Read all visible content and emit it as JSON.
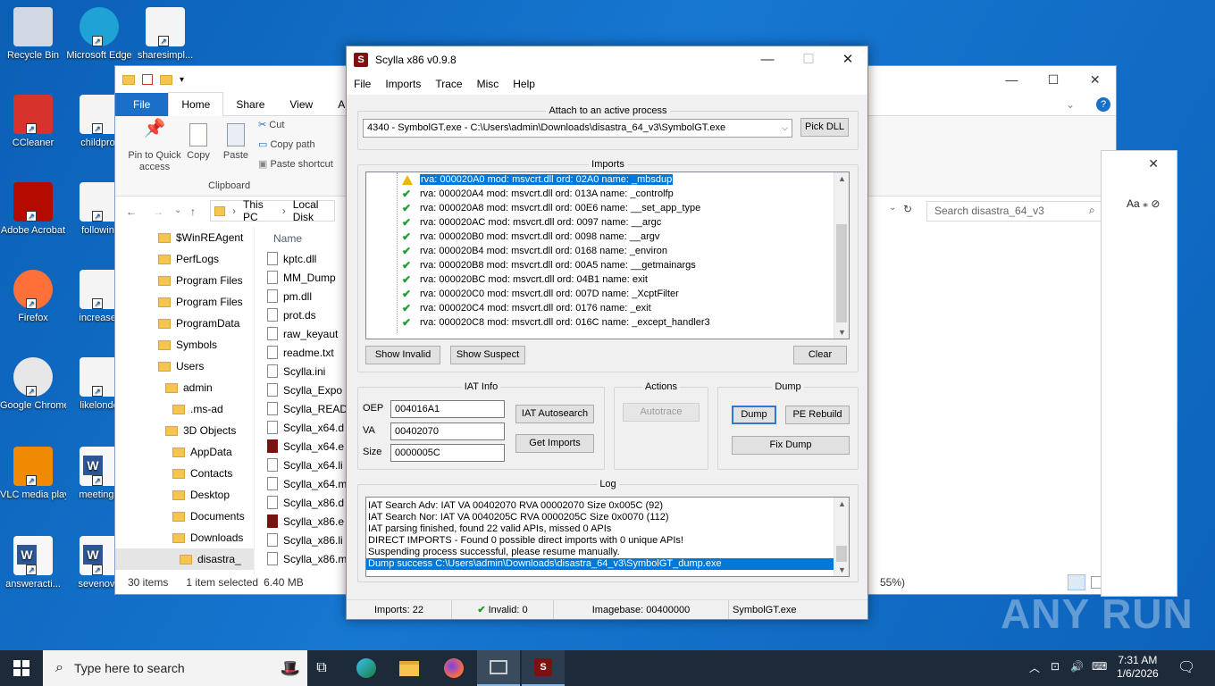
{
  "desktop_icons": [
    {
      "label": "Recycle Bin",
      "icon": "recycle-bin-icon"
    },
    {
      "label": "Microsoft Edge",
      "icon": "edge-icon"
    },
    {
      "label": "sharesimpl...",
      "icon": "image-file-icon"
    },
    {
      "label": "CCleaner",
      "icon": "ccleaner-icon"
    },
    {
      "label": "childprof",
      "icon": "image-file-icon"
    },
    {
      "label": "Adobe Acrobat",
      "icon": "acrobat-icon"
    },
    {
      "label": "followint",
      "icon": "image-file-icon"
    },
    {
      "label": "Firefox",
      "icon": "firefox-icon"
    },
    {
      "label": "increaser",
      "icon": "image-file-icon"
    },
    {
      "label": "Google Chrome",
      "icon": "chrome-icon"
    },
    {
      "label": "likelondo",
      "icon": "image-file-icon"
    },
    {
      "label": "VLC media player",
      "icon": "vlc-icon"
    },
    {
      "label": "meetingb",
      "icon": "word-doc-icon"
    },
    {
      "label": "answeracti...",
      "icon": "word-doc-icon"
    },
    {
      "label": "sevenove",
      "icon": "word-doc-icon"
    }
  ],
  "explorer": {
    "tabs": [
      "File",
      "Home",
      "Share",
      "View",
      "Ap"
    ],
    "ribbon": {
      "pin": "Pin to Quick access",
      "copy": "Copy",
      "paste": "Paste",
      "cut": "Cut",
      "copy_path": "Copy path",
      "paste_shortcut": "Paste shortcut",
      "group": "Clipboard"
    },
    "address": [
      "This PC",
      "Local Disk"
    ],
    "search_placeholder": "Search disastra_64_v3",
    "column_name": "Name",
    "nav": [
      "$WinREAgent",
      "PerfLogs",
      "Program Files",
      "Program Files",
      "ProgramData",
      "Symbols",
      "Users",
      "admin",
      ".ms-ad",
      "3D Objects",
      "AppData",
      "Contacts",
      "Desktop",
      "Documents",
      "Downloads",
      "disastra_"
    ],
    "files": [
      "kptc.dll",
      "MM_Dump",
      "pm.dll",
      "prot.ds",
      "raw_keyaut",
      "readme.txt",
      "Scylla.ini",
      "Scylla_Expo",
      "Scylla_READ",
      "Scylla_x64.d",
      "Scylla_x64.e",
      "Scylla_x64.li",
      "Scylla_x64.m",
      "Scylla_x86.d",
      "Scylla_x86.e",
      "Scylla_x86.li",
      "Scylla_x86.m"
    ],
    "status": {
      "count": "30 items",
      "selected": "1 item selected",
      "size": "6.40 MB"
    },
    "zoom_text": "55%)"
  },
  "scylla": {
    "title": "Scylla x86 v0.9.8",
    "menu": [
      "File",
      "Imports",
      "Trace",
      "Misc",
      "Help"
    ],
    "attach_label": "Attach to an active process",
    "process": "4340 - SymbolGT.exe - C:\\Users\\admin\\Downloads\\disastra_64_v3\\SymbolGT.exe",
    "pick_dll": "Pick DLL",
    "imports_label": "Imports",
    "imports": [
      {
        "text": "rva: 000020A0 mod: msvcrt.dll ord: 02A0 name: _mbsdup",
        "status": "warn",
        "selected": true
      },
      {
        "text": "rva: 000020A4 mod: msvcrt.dll ord: 013A name: _controlfp",
        "status": "ok"
      },
      {
        "text": "rva: 000020A8 mod: msvcrt.dll ord: 00E6 name: __set_app_type",
        "status": "ok"
      },
      {
        "text": "rva: 000020AC mod: msvcrt.dll ord: 0097 name: __argc",
        "status": "ok"
      },
      {
        "text": "rva: 000020B0 mod: msvcrt.dll ord: 0098 name: __argv",
        "status": "ok"
      },
      {
        "text": "rva: 000020B4 mod: msvcrt.dll ord: 0168 name: _environ",
        "status": "ok"
      },
      {
        "text": "rva: 000020B8 mod: msvcrt.dll ord: 00A5 name: __getmainargs",
        "status": "ok"
      },
      {
        "text": "rva: 000020BC mod: msvcrt.dll ord: 04B1 name: exit",
        "status": "ok"
      },
      {
        "text": "rva: 000020C0 mod: msvcrt.dll ord: 007D name: _XcptFilter",
        "status": "ok"
      },
      {
        "text": "rva: 000020C4 mod: msvcrt.dll ord: 0176 name: _exit",
        "status": "ok"
      },
      {
        "text": "rva: 000020C8 mod: msvcrt.dll ord: 016C name: _except_handler3",
        "status": "ok"
      }
    ],
    "show_invalid": "Show Invalid",
    "show_suspect": "Show Suspect",
    "clear": "Clear",
    "iat_label": "IAT Info",
    "oep_label": "OEP",
    "oep": "004016A1",
    "va_label": "VA",
    "va": "00402070",
    "size_label": "Size",
    "size": "0000005C",
    "iat_autosearch": "IAT Autosearch",
    "get_imports": "Get Imports",
    "actions_label": "Actions",
    "autotrace": "Autotrace",
    "dump_label": "Dump",
    "dump": "Dump",
    "pe_rebuild": "PE Rebuild",
    "fix_dump": "Fix Dump",
    "log_label": "Log",
    "log": [
      "IAT Search Adv: IAT VA 00402070 RVA 00002070 Size 0x005C (92)",
      "IAT Search Nor: IAT VA 0040205C RVA 0000205C Size 0x0070 (112)",
      "IAT parsing finished, found 22 valid APIs, missed 0 APIs",
      "DIRECT IMPORTS - Found 0 possible direct imports with 0 unique APIs!",
      "Suspending process successful, please resume manually.",
      "Dump success C:\\Users\\admin\\Downloads\\disastra_64_v3\\SymbolGT_dump.exe"
    ],
    "status": {
      "imports": "Imports: 22",
      "invalid": "Invalid: 0",
      "imagebase": "Imagebase: 00400000",
      "module": "SymbolGT.exe"
    }
  },
  "taskbar": {
    "search": "Type here to search",
    "time": "7:31 AM",
    "date": "1/6/2026"
  },
  "watermark": "ANY RUN"
}
